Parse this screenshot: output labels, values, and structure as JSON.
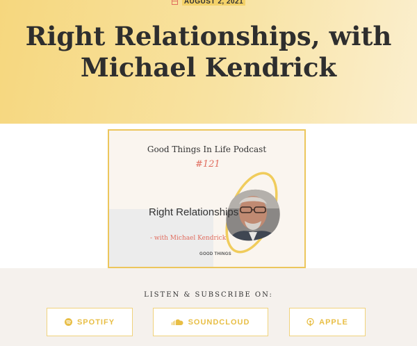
{
  "post": {
    "date": "AUGUST 2, 2021",
    "title": "Right Relationships, with Michael Kendrick"
  },
  "cover": {
    "podcast_name": "Good Things In Life Podcast",
    "episode_number": "#121",
    "title": "Right Relationships",
    "guest": "- with Michael Kendrick",
    "brand": "GOOD THINGS"
  },
  "subscribe": {
    "heading": "LISTEN & SUBSCRIBE ON:",
    "buttons": [
      {
        "label": "SPOTIFY",
        "icon": "spotify-icon"
      },
      {
        "label": "SOUNDCLOUD",
        "icon": "soundcloud-icon"
      },
      {
        "label": "APPLE",
        "icon": "apple-podcasts-icon"
      }
    ]
  },
  "colors": {
    "accent": "#f0d27c",
    "accent_text": "#e8be45",
    "coral": "#e06d5f",
    "hero_start": "#f6d77e",
    "hero_end": "#fbefcf",
    "subscribe_bg": "#f5f1ed"
  }
}
